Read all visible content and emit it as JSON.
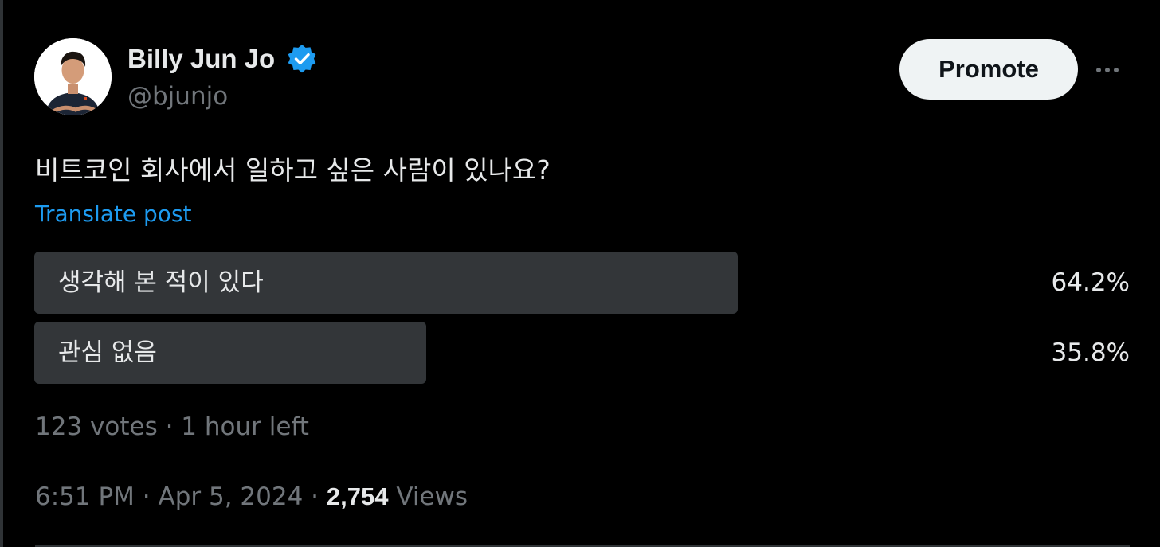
{
  "author": {
    "display_name": "Billy Jun Jo",
    "handle": "@bjunjo",
    "verified": true,
    "avatar_icon": "avatar-photo"
  },
  "actions": {
    "promote_label": "Promote",
    "more_icon": "more-dots-icon"
  },
  "post": {
    "text": "비트코인 회사에서 일하고 싶은 사람이 있나요?",
    "translate_label": "Translate post"
  },
  "poll": {
    "options": [
      {
        "label": "생각해 본 적이 있다",
        "percent_label": "64.2%",
        "percent": 64.2
      },
      {
        "label": "관심 없음",
        "percent_label": "35.8%",
        "percent": 35.8
      }
    ],
    "votes": "123 votes",
    "separator": "·",
    "time_left": "1 hour left"
  },
  "meta": {
    "time": "6:51 PM",
    "separator": "·",
    "date": "Apr 5, 2024",
    "views_count": "2,754",
    "views_label": "Views"
  },
  "colors": {
    "background": "#000000",
    "text_primary": "#e7e9ea",
    "text_secondary": "#71767b",
    "link": "#1d9bf0",
    "verified_badge": "#1d9bf0",
    "poll_bar": "#333639",
    "button_bg": "#eff3f4"
  }
}
